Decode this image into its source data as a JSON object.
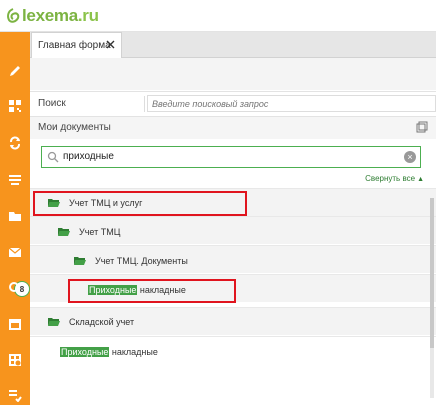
{
  "header": {
    "logo_main": "lexema",
    "logo_tld": ".ru"
  },
  "sidebar": {
    "items": [
      {
        "icon": "pencil-icon"
      },
      {
        "icon": "qr-icon"
      },
      {
        "icon": "sync-icon"
      },
      {
        "icon": "list-icon"
      },
      {
        "icon": "folder-icon"
      },
      {
        "icon": "mail-icon"
      },
      {
        "icon": "search-icon"
      },
      {
        "icon": "calendar-icon"
      },
      {
        "icon": "table-icon"
      },
      {
        "icon": "checklist-icon"
      }
    ],
    "mail_badge": "8"
  },
  "tabs": [
    {
      "label": "Главная форма"
    }
  ],
  "search": {
    "label": "Поиск",
    "placeholder": "Введите поисковый запрос"
  },
  "documents": {
    "title": "Мои документы",
    "filter_value": "приходные",
    "collapse_all": "Свернуть все"
  },
  "tree": {
    "n1": "Учет ТМЦ и услуг",
    "n2": "Учет ТМЦ",
    "n3": "Учет ТМЦ. Документы",
    "n4_hl": "Приходные",
    "n4_rest": " накладные",
    "n5": "Складской учет",
    "n6_hl": "Приходные",
    "n6_rest": " накладные"
  },
  "colors": {
    "sidebar": "#f7941d",
    "accent_green": "#43a047",
    "highlight_frame": "#e0141e"
  }
}
